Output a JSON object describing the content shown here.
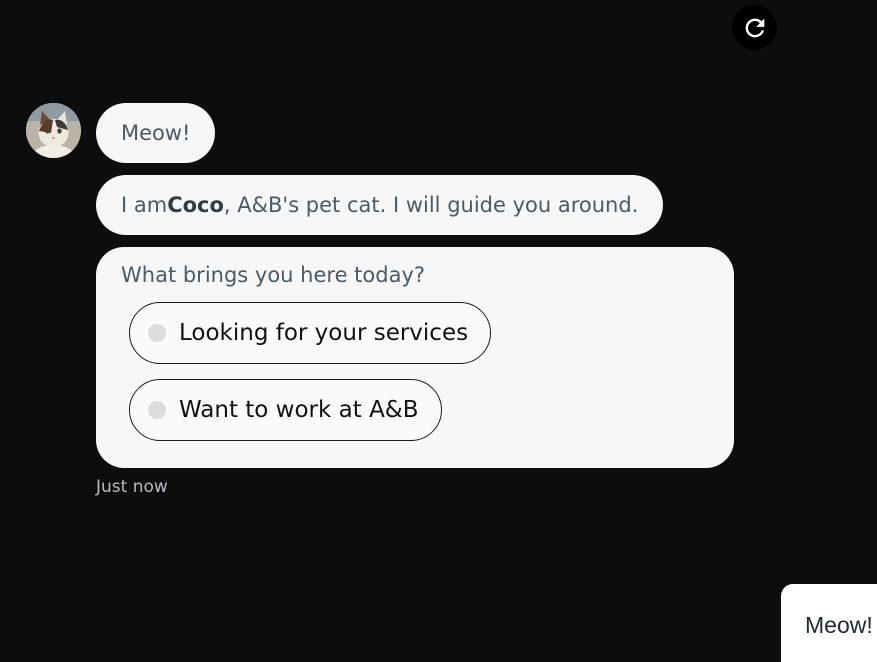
{
  "header": {
    "refresh_icon": "refresh-icon"
  },
  "bot": {
    "avatar_icon": "cat-avatar"
  },
  "messages": [
    {
      "text": "Meow!"
    },
    {
      "prefix": "I am ",
      "bold": "Coco",
      "suffix": ", A&B's pet cat. I will guide you around."
    },
    {
      "text": "What brings you here today?"
    }
  ],
  "options": [
    {
      "label": "Looking for your services"
    },
    {
      "label": "Want to work at A&B"
    }
  ],
  "timestamp": "Just now",
  "launcher": {
    "label": "Meow!"
  },
  "colors": {
    "background": "#0d0d0d",
    "bubble": "#f7f7f7",
    "bubble_text": "#4a5a66"
  }
}
